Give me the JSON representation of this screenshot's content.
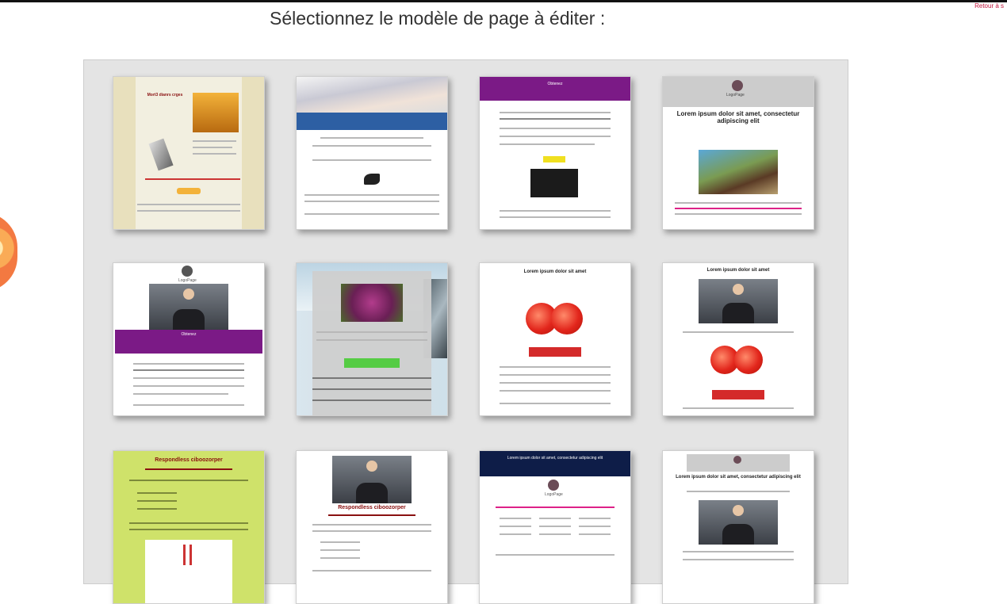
{
  "header": {
    "title": "Sélectionnez le modèle de page à éditer :",
    "top_link": "Retour à s"
  },
  "templates": [
    {
      "id": 1,
      "name": "template-1",
      "heading": "Mort3 dianrs crges"
    },
    {
      "id": 2,
      "name": "template-2"
    },
    {
      "id": 3,
      "name": "template-3",
      "heading": "Obtenez"
    },
    {
      "id": 4,
      "name": "template-4",
      "heading": "Lorem ipsum dolor sit amet, consectetur adipiscing elit",
      "logo": "LogoPage"
    },
    {
      "id": 5,
      "name": "template-5",
      "heading": "Obtenez",
      "logo": "LogoPage"
    },
    {
      "id": 6,
      "name": "template-6"
    },
    {
      "id": 7,
      "name": "template-7",
      "heading": "Lorem ipsum dolor sit amet"
    },
    {
      "id": 8,
      "name": "template-8",
      "heading": "Lorem ipsum dolor sit amet"
    },
    {
      "id": 9,
      "name": "template-9",
      "heading": "Respondless ciboozorper"
    },
    {
      "id": 10,
      "name": "template-10",
      "heading": "Respondless ciboozorper"
    },
    {
      "id": 11,
      "name": "template-11",
      "heading": "Lorem ipsum dolor sit amet, consectetur adipiscing elit",
      "logo": "LogoPage"
    },
    {
      "id": 12,
      "name": "template-12",
      "heading": "Lorem ipsum dolor sit amet, consectetur adipiscing elit"
    }
  ],
  "colors": {
    "panel": "#e4e4e4",
    "purple": "#7b1a86",
    "navy": "#0e1d48",
    "lime": "#cfe26a",
    "accent_red": "#d42a2a",
    "title_text": "#333333"
  }
}
